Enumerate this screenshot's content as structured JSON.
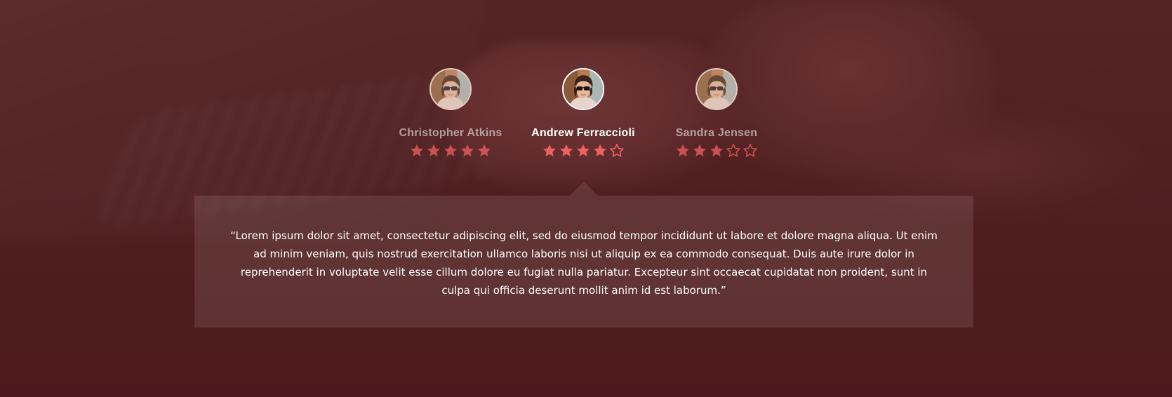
{
  "testimonials": {
    "reviewers": [
      {
        "name": "Christopher Atkins",
        "rating": 5,
        "max_rating": 5,
        "active": false,
        "avatar_icon": "avatar-man-sunglasses"
      },
      {
        "name": "Andrew Ferraccioli",
        "rating": 4,
        "max_rating": 5,
        "active": true,
        "avatar_icon": "avatar-man-sunglasses"
      },
      {
        "name": "Sandra Jensen",
        "rating": 3,
        "max_rating": 5,
        "active": false,
        "avatar_icon": "avatar-man-sunglasses"
      }
    ],
    "quote": "“Lorem ipsum dolor sit amet, consectetur adipiscing elit, sed do eiusmod tempor incididunt ut labore et dolore magna aliqua. Ut enim ad minim veniam, quis nostrud exercitation ullamco laboris nisi ut aliquip ex ea commodo consequat. Duis aute irure dolor in reprehenderit in voluptate velit esse cillum dolore eu fugiat nulla pariatur. Excepteur sint occaecat cupidatat non proident, sunt in culpa qui officia deserunt mollit anim id est laborum.”"
  },
  "colors": {
    "star_filled": "#ef6161",
    "star_empty_stroke": "#ef6161",
    "background": "#4f1d1f",
    "quote_text": "#ffffff"
  }
}
